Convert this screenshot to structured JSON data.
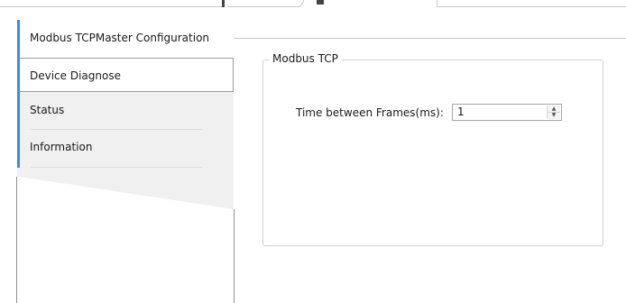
{
  "nav": {
    "items": [
      {
        "label": "Modbus TCPMaster Configuration"
      },
      {
        "label": "Device Diagnose"
      },
      {
        "label": "Status"
      },
      {
        "label": "Information"
      }
    ]
  },
  "main": {
    "group_title": "Modbus TCP",
    "field": {
      "label": "Time between Frames(ms):",
      "value": "1"
    }
  },
  "icons": {
    "spin_up": "spin-up-arrow-icon",
    "spin_down": "spin-down-arrow-icon"
  }
}
